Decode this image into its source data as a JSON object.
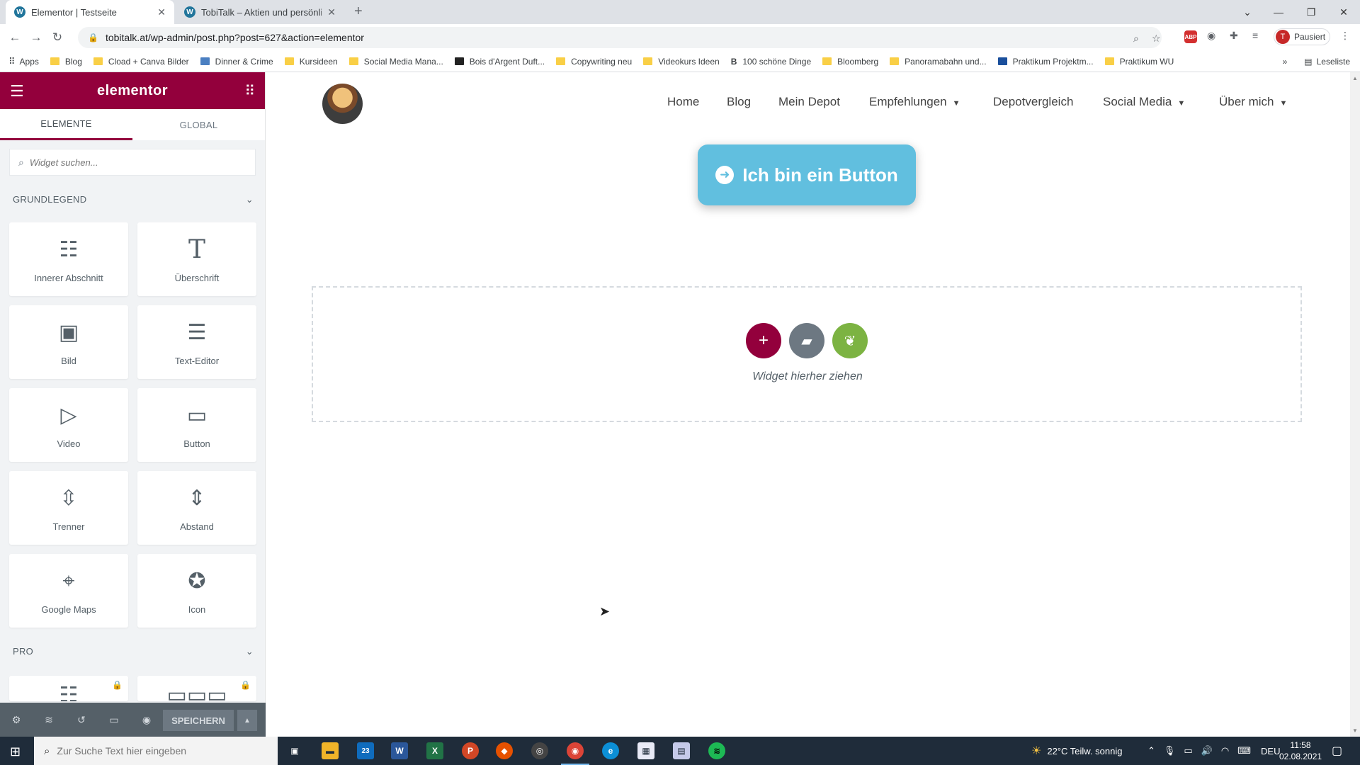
{
  "browser": {
    "tabs": [
      {
        "title": "Elementor | Testseite",
        "active": true
      },
      {
        "title": "TobiTalk – Aktien und persönliche",
        "active": false
      }
    ],
    "new_tab": "+",
    "url": "tobitalk.at/wp-admin/post.php?post=627&action=elementor",
    "profile": {
      "initial": "T",
      "label": "Pausiert"
    },
    "abp_label": "ABP",
    "bookmarks": [
      {
        "label": "Apps",
        "icon": "grid-icon"
      },
      {
        "label": "Blog",
        "icon": "folder-icon"
      },
      {
        "label": "Cload + Canva Bilder",
        "icon": "folder-icon"
      },
      {
        "label": "Dinner & Crime",
        "icon": "jd-icon"
      },
      {
        "label": "Kursideen",
        "icon": "folder-icon"
      },
      {
        "label": "Social Media Mana...",
        "icon": "folder-icon"
      },
      {
        "label": "Bois d'Argent Duft...",
        "icon": "site-icon"
      },
      {
        "label": "Copywriting neu",
        "icon": "folder-icon"
      },
      {
        "label": "Videokurs Ideen",
        "icon": "folder-icon"
      },
      {
        "label": "100 schöne Dinge",
        "icon": "b-icon"
      },
      {
        "label": "Bloomberg",
        "icon": "folder-icon"
      },
      {
        "label": "Panoramabahn und...",
        "icon": "folder-icon"
      },
      {
        "label": "Praktikum Projektm...",
        "icon": "j-icon"
      },
      {
        "label": "Praktikum WU",
        "icon": "folder-icon"
      }
    ],
    "more_bookmarks": "»",
    "reading_list": "Leseliste"
  },
  "panel": {
    "logo": "elementor",
    "tabs": [
      "ELEMENTE",
      "GLOBAL"
    ],
    "search_placeholder": "Widget suchen...",
    "categories": [
      "GRUNDLEGEND",
      "PRO"
    ],
    "widgets": [
      {
        "label": "Innerer Abschnitt",
        "icon": "inner-section-icon"
      },
      {
        "label": "Überschrift",
        "icon": "heading-icon"
      },
      {
        "label": "Bild",
        "icon": "image-icon"
      },
      {
        "label": "Text-Editor",
        "icon": "text-editor-icon"
      },
      {
        "label": "Video",
        "icon": "video-icon"
      },
      {
        "label": "Button",
        "icon": "button-icon"
      },
      {
        "label": "Trenner",
        "icon": "divider-icon"
      },
      {
        "label": "Abstand",
        "icon": "spacer-icon"
      },
      {
        "label": "Google Maps",
        "icon": "map-icon"
      },
      {
        "label": "Icon",
        "icon": "star-icon"
      }
    ],
    "footer": {
      "save_label": "SPEICHERN"
    }
  },
  "site": {
    "nav": [
      {
        "label": "Home",
        "dropdown": false
      },
      {
        "label": "Blog",
        "dropdown": false
      },
      {
        "label": "Mein Depot",
        "dropdown": false
      },
      {
        "label": "Empfehlungen",
        "dropdown": true
      },
      {
        "label": "Depotvergleich",
        "dropdown": false
      },
      {
        "label": "Social Media",
        "dropdown": true
      },
      {
        "label": "Über mich",
        "dropdown": true
      }
    ],
    "button_label": "Ich bin ein Button",
    "dropzone_text": "Widget hierher ziehen"
  },
  "colors": {
    "elementor_brand": "#93003c",
    "button_blue": "#61bfdf",
    "dz_add": "#93003c",
    "dz_template": "#6d7882",
    "dz_envato": "#7cb342"
  },
  "taskbar": {
    "search_placeholder": "Zur Suche Text hier eingeben",
    "mail_badge": "23",
    "weather": "22°C  Teilw. sonnig",
    "language": "DEU",
    "time": "11:58",
    "date": "02.08.2021"
  }
}
